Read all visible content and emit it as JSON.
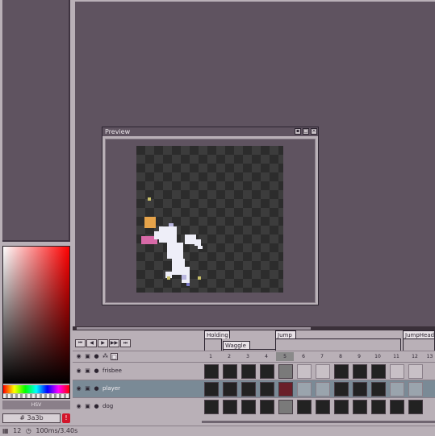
{
  "preview": {
    "title": "Preview",
    "buttons": [
      "▪",
      "□",
      "×"
    ]
  },
  "color_panel": {
    "hsv_label": "HSV",
    "hex_value": "# 3a3b",
    "alert_glyph": "!",
    "colors": {
      "hue_start": "#ff0000",
      "panel": "#b9b0b7"
    }
  },
  "status": {
    "frame_label": "12",
    "timing": "100ms/3.40s"
  },
  "timeline": {
    "transport_buttons": [
      "⏮",
      "◀",
      "▶",
      "▶▶",
      "⏭"
    ],
    "tags": [
      "Holding",
      "Waggle",
      "Jump",
      "JumpHead"
    ],
    "frames": [
      "1",
      "2",
      "3",
      "4",
      "5",
      "6",
      "7",
      "8",
      "9",
      "10",
      "11",
      "12",
      "13"
    ],
    "active_frame": "5",
    "layers": [
      {
        "name": "frisbee"
      },
      {
        "name": "player"
      },
      {
        "name": "dog"
      }
    ]
  }
}
